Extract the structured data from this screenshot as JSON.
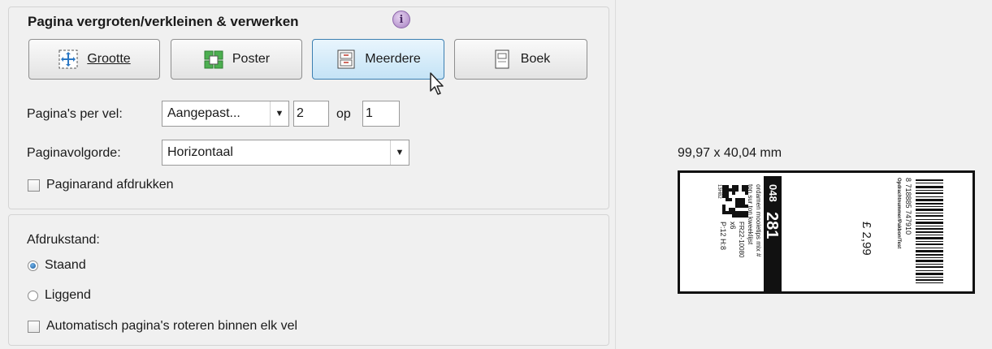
{
  "scale_section": {
    "title": "Pagina vergroten/verkleinen & verwerken",
    "buttons": {
      "grootte": "Grootte",
      "poster": "Poster",
      "meerdere": "Meerdere",
      "boek": "Boek"
    },
    "pages_per_sheet_label": "Pagina's per vel:",
    "pages_per_sheet_select": "Aangepast...",
    "pages_per_sheet_cols": "2",
    "op_label": "op",
    "pages_per_sheet_rows": "1",
    "page_order_label": "Paginavolgorde:",
    "page_order_select": "Horizontaal",
    "print_page_border_label": "Paginarand afdrukken",
    "print_page_border_checked": false
  },
  "orientation_section": {
    "title": "Afdrukstand:",
    "portrait_label": "Staand",
    "landscape_label": "Liggend",
    "selected": "Staand",
    "auto_rotate_label": "Automatisch pagina's roteren binnen elk vel",
    "auto_rotate_checked": false
  },
  "preview": {
    "dimensions": "99,97 x 40,04 mm",
    "label": {
      "code_top": "048",
      "code_main": "281",
      "desc_line1": "ordamen mooietips mix #",
      "desc_line2": "ton sur ton kweeklijst",
      "desc_line3": "FR22-10080",
      "qty": "x6",
      "size": "P:12 H:8",
      "small_code": "13H82",
      "price": "£ 2,99",
      "barcode_number": "8 718885 747910",
      "barcode_caption": "Opdrachtnummer/Pakbon/Test"
    }
  },
  "colors": {
    "active_button": "#c4e3f6",
    "radio_selected": "#1b5a9a"
  }
}
